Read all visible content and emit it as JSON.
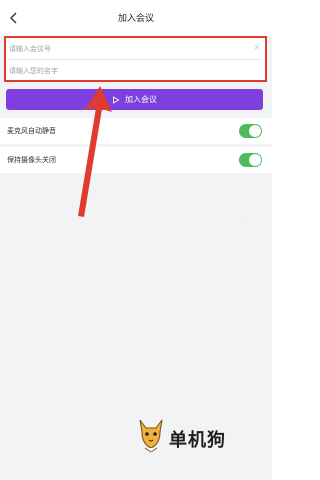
{
  "header": {
    "title": "加入会议"
  },
  "form": {
    "meeting_id_placeholder": "请输入会议号",
    "name_placeholder": "请输入您的名字"
  },
  "join_button": {
    "label": "加入会议",
    "color": "#7d3fe0"
  },
  "settings": [
    {
      "label": "麦克风自动静音",
      "enabled": true
    },
    {
      "label": "保持摄像头关闭",
      "enabled": true
    }
  ],
  "annotation": {
    "highlight_color": "#e23a2e"
  },
  "watermark": {
    "text": "单机狗"
  }
}
